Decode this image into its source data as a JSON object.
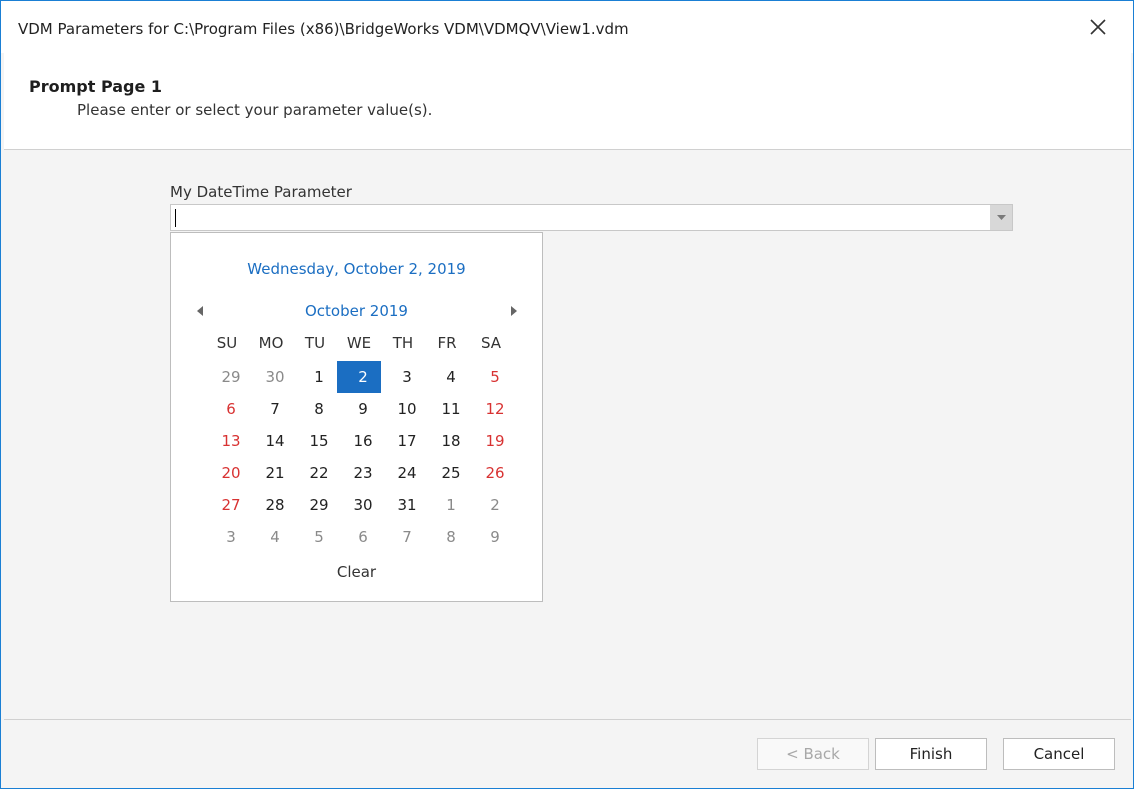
{
  "window": {
    "title": "VDM Parameters for C:\\Program Files (x86)\\BridgeWorks VDM\\VDMQV\\View1.vdm",
    "close_icon": "close-icon"
  },
  "header": {
    "title": "Prompt Page 1",
    "subtitle": "Please enter or select your parameter value(s)."
  },
  "parameter": {
    "label": "My DateTime Parameter",
    "value": ""
  },
  "calendar": {
    "full_date": "Wednesday, October 2, 2019",
    "month_label": "October 2019",
    "day_names": [
      "SU",
      "MO",
      "TU",
      "WE",
      "TH",
      "FR",
      "SA"
    ],
    "weeks": [
      [
        "29",
        "30",
        "1",
        "2",
        "3",
        "4",
        "5"
      ],
      [
        "6",
        "7",
        "8",
        "9",
        "10",
        "11",
        "12"
      ],
      [
        "13",
        "14",
        "15",
        "16",
        "17",
        "18",
        "19"
      ],
      [
        "20",
        "21",
        "22",
        "23",
        "24",
        "25",
        "26"
      ],
      [
        "27",
        "28",
        "29",
        "30",
        "31",
        "1",
        "2"
      ],
      [
        "3",
        "4",
        "5",
        "6",
        "7",
        "8",
        "9"
      ]
    ],
    "selected_day": "2",
    "clear_label": "Clear"
  },
  "buttons": {
    "back_label": "< Back",
    "finish_label": "Finish",
    "cancel_label": "Cancel"
  },
  "colors": {
    "accent": "#1b6ec2",
    "weekend": "#d83232",
    "window_border": "#1a7fd4"
  }
}
